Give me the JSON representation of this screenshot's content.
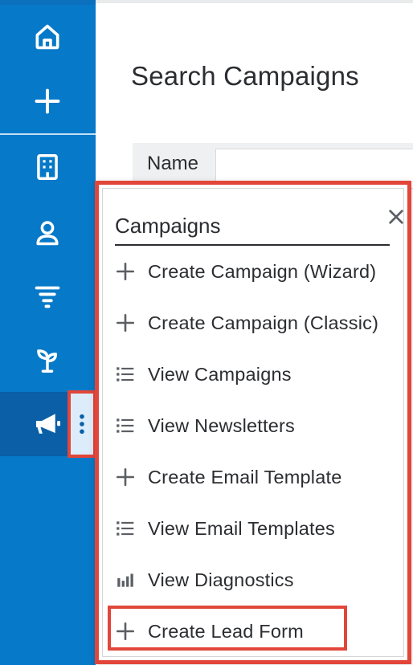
{
  "page": {
    "title": "Search Campaigns",
    "filter_label": "Name",
    "filter_value": ""
  },
  "sidebar": {
    "items": [
      {
        "icon": "home-icon"
      },
      {
        "icon": "plus-icon"
      },
      {
        "icon": "building-icon"
      },
      {
        "icon": "person-icon"
      },
      {
        "icon": "funnel-icon"
      },
      {
        "icon": "sprout-icon"
      },
      {
        "icon": "megaphone-icon",
        "active": true
      }
    ],
    "more_icon": "kebab-icon"
  },
  "menu": {
    "title": "Campaigns",
    "items": [
      {
        "label": "Create Campaign (Wizard)",
        "icon": "plus-icon"
      },
      {
        "label": "Create Campaign (Classic)",
        "icon": "plus-icon"
      },
      {
        "label": "View Campaigns",
        "icon": "list-icon"
      },
      {
        "label": "View Newsletters",
        "icon": "list-icon"
      },
      {
        "label": "Create Email Template",
        "icon": "plus-icon"
      },
      {
        "label": "View Email Templates",
        "icon": "list-icon"
      },
      {
        "label": "View Diagnostics",
        "icon": "bar-chart-icon"
      },
      {
        "label": "Create Lead Form",
        "icon": "plus-icon",
        "highlighted": true
      }
    ]
  },
  "colors": {
    "sidebar": "#0679c8",
    "sidebar_active": "#0a5fa7",
    "highlight": "#e2463a",
    "text": "#2b2d31"
  }
}
